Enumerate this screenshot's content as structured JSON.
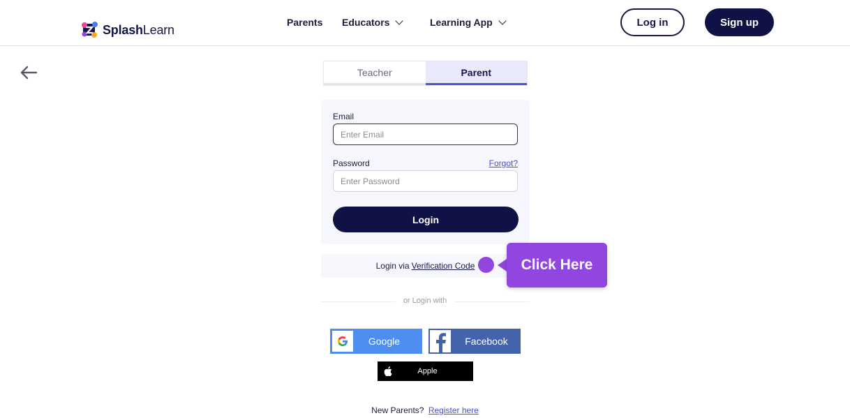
{
  "header": {
    "logo_bold": "Splash",
    "logo_light": "Learn",
    "nav": [
      {
        "label": "Parents"
      },
      {
        "label": "Educators"
      },
      {
        "label": "Learning App"
      }
    ],
    "login_label": "Log in",
    "signup_label": "Sign up"
  },
  "tabs": [
    {
      "label": "Teacher",
      "active": false
    },
    {
      "label": "Parent",
      "active": true
    }
  ],
  "form": {
    "email_label": "Email",
    "email_placeholder": "Enter Email",
    "password_label": "Password",
    "password_placeholder": "Enter Password",
    "forgot_label": "Forgot?",
    "login_button": "Login"
  },
  "verification": {
    "prefix": "Login via",
    "link": "Verification Code"
  },
  "tooltip": {
    "text": "Click Here",
    "color": "#9146e0"
  },
  "divider_text": "or Login with",
  "social": {
    "google": "Google",
    "facebook": "Facebook",
    "apple": "Apple"
  },
  "footer": {
    "prefix": "New Parents?",
    "link": "Register here"
  },
  "colors": {
    "brand_dark": "#101246",
    "accent": "#4b50c9"
  }
}
